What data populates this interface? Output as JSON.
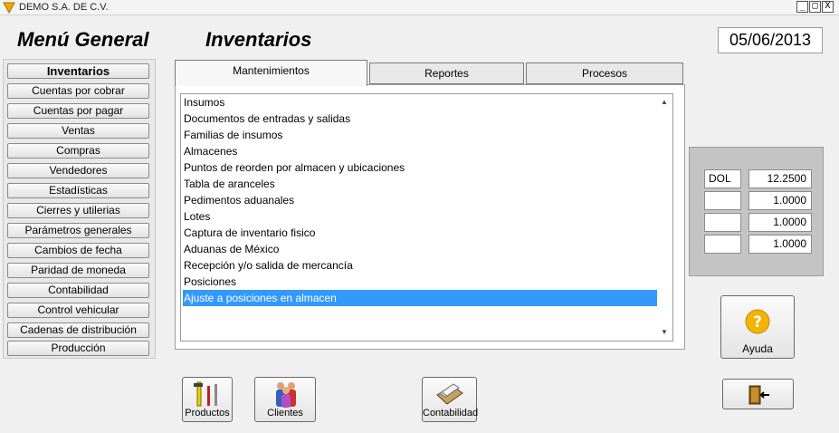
{
  "window": {
    "title": "DEMO  S.A. DE C.V.",
    "controls": [
      "_",
      "□",
      "X"
    ]
  },
  "header": {
    "menu_title": "Menú General",
    "section_title": "Inventarios",
    "date": "05/06/2013"
  },
  "sidebar": {
    "items": [
      {
        "label": "Inventarios"
      },
      {
        "label": "Cuentas por cobrar"
      },
      {
        "label": "Cuentas por pagar"
      },
      {
        "label": "Ventas"
      },
      {
        "label": "Compras"
      },
      {
        "label": "Vendedores"
      },
      {
        "label": "Estadísticas"
      },
      {
        "label": "Cierres y utilerias"
      },
      {
        "label": "Parámetros generales"
      },
      {
        "label": "Cambios de fecha"
      },
      {
        "label": "Paridad de moneda"
      },
      {
        "label": "Contabilidad"
      },
      {
        "label": "Control vehicular"
      },
      {
        "label": "Cadenas de distribución"
      },
      {
        "label": "Producción"
      }
    ]
  },
  "tabs": [
    {
      "label": "Mantenimientos"
    },
    {
      "label": "Reportes"
    },
    {
      "label": "Procesos"
    }
  ],
  "list": {
    "items": [
      "Insumos",
      "Documentos de entradas y salidas",
      "Familias de insumos",
      "Almacenes",
      "Puntos de reorden por almacen y ubicaciones",
      "Tabla de aranceles",
      "Pedimentos aduanales",
      "Lotes",
      "Captura de inventario fisico",
      "Aduanas de México",
      "Recepción y/o salida de mercancía",
      "Posiciones",
      "Ajuste a  posiciones en almacen"
    ],
    "selected_index": 12
  },
  "currencies": [
    {
      "code": "DOL",
      "rate": "12.2500"
    },
    {
      "code": "",
      "rate": "1.0000"
    },
    {
      "code": "",
      "rate": "1.0000"
    },
    {
      "code": "",
      "rate": "1.0000"
    }
  ],
  "buttons": {
    "help": "Ayuda",
    "productos": "Productos",
    "clientes": "Clientes",
    "contabilidad": "Contabilidad"
  },
  "colors": {
    "selection": "#3399ff",
    "help_icon": "#f0b000"
  }
}
